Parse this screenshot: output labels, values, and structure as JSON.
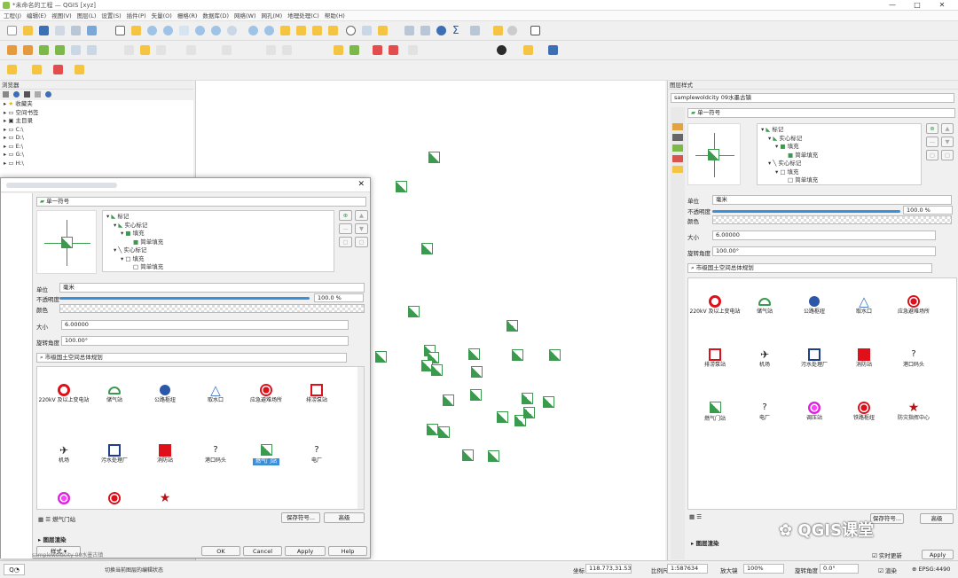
{
  "window": {
    "title": "*未命名的工程 — QGIS [xyz]",
    "controls": [
      "—",
      "□",
      "✕"
    ]
  },
  "menu": [
    "工程(J)",
    "编辑(E)",
    "视图(V)",
    "图层(L)",
    "设置(S)",
    "插件(P)",
    "矢量(O)",
    "栅格(R)",
    "数据库(D)",
    "网络(W)",
    "网孔(M)",
    "地理处理(C)",
    "帮助(H)"
  ],
  "browser": {
    "title": "浏览器",
    "items": [
      "收藏夹",
      "空间书签",
      "主目录",
      "C:\\",
      "D:\\",
      "E:\\",
      "G:\\",
      "H:\\"
    ]
  },
  "layerstyle": {
    "title": "图层样式",
    "layer": "samplewoldcity 09水墨古镇"
  },
  "symbol": {
    "top": "单一符号",
    "tree": [
      "标记",
      "实心标记",
      "填充",
      "简单填充",
      "实心标记",
      "填充",
      "简单填充"
    ],
    "unit_label": "单位",
    "unit": "毫米",
    "opacity_label": "不透明度",
    "opacity": "100.0 %",
    "color_label": "颜色",
    "size_label": "大小",
    "size": "6.00000",
    "rotation_label": "旋转角度",
    "rotation": "100.00°",
    "library": "市级国土空间总体规划",
    "library_right": "市级国土空间总体规划",
    "selected": "燃气门站",
    "save_btn": "保存符号...",
    "advanced_btn": "高级",
    "render_label": "图层渲染",
    "style_btn": "样式",
    "ok": "OK",
    "cancel": "Cancel",
    "apply": "Apply",
    "help": "Help",
    "live_update": "实时更新"
  },
  "dialog_symbols": [
    "220kV 及以上变电站",
    "储气站",
    "公路枢纽",
    "取水口",
    "应急避难场所",
    "排涝泵站",
    "机场",
    "污水处理厂",
    "消防站",
    "港口码头",
    "燃气门站",
    "电厂"
  ],
  "right_symbols": [
    "220kV 及以上变电站",
    "储气站",
    "公路枢纽",
    "取水口",
    "应急避难场所",
    "排涝泵站",
    "机场",
    "污水处理厂",
    "消防站",
    "港口码头",
    "燃气门站",
    "电厂",
    "调压站",
    "铁路枢纽",
    "防灾指挥中心"
  ],
  "status": {
    "coord_label": "坐标",
    "coord": "118.773,31.539",
    "scale_label": "比例尺",
    "scale": "1:587634",
    "magnifier_label": "放大镜",
    "magnifier": "100%",
    "rotation_label": "旋转角度",
    "rotation": "0.0°",
    "render_label": "渲染",
    "crs": "EPSG:4490",
    "hint": "切换当前图层的编辑状态",
    "layer_hint": "samplewoldcity 09水墨古镇"
  },
  "watermark": "QGIS课堂",
  "colors": {
    "marker_green": "#3a9a4e",
    "symbol_red": "#e0101a",
    "symbol_blue": "#2c57a9",
    "selection": "#3b8fd9"
  }
}
